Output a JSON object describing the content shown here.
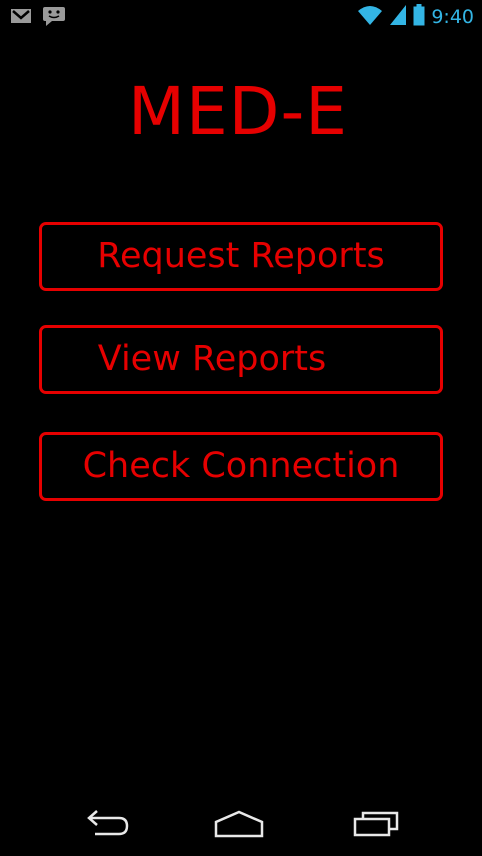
{
  "status_bar": {
    "time": "9:40",
    "icons": [
      "gmail-icon",
      "messenger-icon",
      "wifi-icon",
      "signal-icon",
      "battery-icon"
    ],
    "accent_color": "#33b5e5"
  },
  "app": {
    "title": "MED-E",
    "accent_color": "#e60000"
  },
  "menu": {
    "request_reports": "Request Reports",
    "view_reports": "View Reports",
    "check_connection": "Check Connection"
  },
  "nav_bar": {
    "icons": [
      "back-icon",
      "home-icon",
      "recent-apps-icon"
    ]
  }
}
